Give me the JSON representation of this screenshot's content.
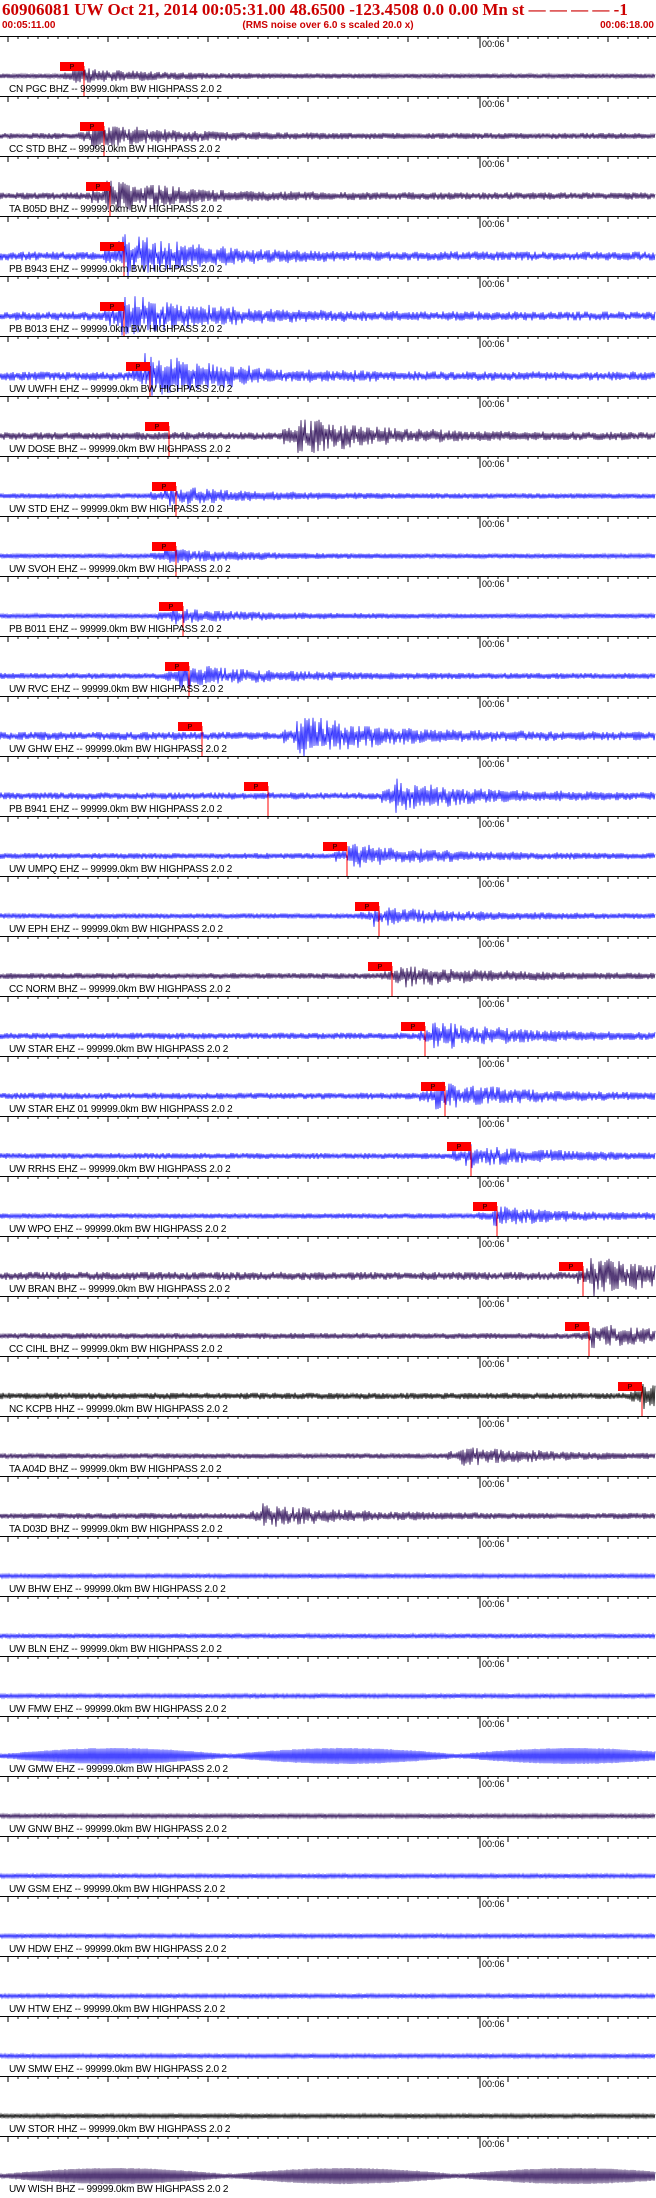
{
  "header": {
    "title": "60906081 UW Oct 21, 2014 00:05:31.00   48.6500  -123.4508   0.0  0.00  Mn  st  — — — —  -1",
    "start_time": "00:05:11.00",
    "rms_note": "(RMS noise over 6.0 s scaled 20.0 x)",
    "end_time": "00:06:18.00"
  },
  "minute_mark": "00:06",
  "pick_label": "P",
  "colors": {
    "trace_blue": "#1a1aff",
    "trace_dark": "#2a0a55",
    "trace_black": "#000000",
    "pick_red": "#ff0000",
    "header_red": "#cc0000"
  },
  "traces": [
    {
      "label": "CN PGC BHZ -- 99999.0km BW HIGHPASS  2.0  2",
      "color": "dark",
      "pick": 0.11,
      "amp": 0.3,
      "event": 0.11
    },
    {
      "label": "CC STD BHZ -- 99999.0km BW HIGHPASS  2.0  2",
      "color": "dark",
      "pick": 0.14,
      "amp": 0.5,
      "event": 0.14
    },
    {
      "label": "TA B05D BHZ -- 99999.0km BW HIGHPASS  2.0  2",
      "color": "dark",
      "pick": 0.15,
      "amp": 0.7,
      "event": 0.16
    },
    {
      "label": "PB B943 EHZ -- 99999.0km BW HIGHPASS  2.0  2",
      "color": "blue",
      "pick": 0.17,
      "amp": 1.0,
      "event": 0.18
    },
    {
      "label": "PB B013 EHZ -- 99999.0km BW HIGHPASS  2.0  2",
      "color": "blue",
      "pick": 0.17,
      "amp": 1.0,
      "event": 0.18
    },
    {
      "label": "UW UWFH EHZ -- 99999.0km BW HIGHPASS  2.0  2",
      "color": "blue",
      "pick": 0.21,
      "amp": 1.0,
      "event": 0.22
    },
    {
      "label": "UW DOSE BHZ -- 99999.0km BW HIGHPASS  2.0  2",
      "color": "dark",
      "pick": 0.24,
      "amp": 0.8,
      "event": 0.45
    },
    {
      "label": "UW STD EHZ -- 99999.0km BW HIGHPASS  2.0  2",
      "color": "blue",
      "pick": 0.25,
      "amp": 0.4,
      "event": 0.25
    },
    {
      "label": "UW SVOH EHZ -- 99999.0km BW HIGHPASS  2.0  2",
      "color": "blue",
      "pick": 0.25,
      "amp": 0.3,
      "event": 0.25
    },
    {
      "label": "PB B011 EHZ -- 99999.0km BW HIGHPASS  2.0  2",
      "color": "blue",
      "pick": 0.26,
      "amp": 0.3,
      "event": 0.26
    },
    {
      "label": "UW RVC EHZ -- 99999.0km BW HIGHPASS  2.0  2",
      "color": "blue",
      "pick": 0.27,
      "amp": 0.5,
      "event": 0.27
    },
    {
      "label": "UW GHW EHZ -- 99999.0km BW HIGHPASS  2.0  2",
      "color": "blue",
      "pick": 0.29,
      "amp": 0.9,
      "event": 0.45
    },
    {
      "label": "PB B941 EHZ -- 99999.0km BW HIGHPASS  2.0  2",
      "color": "blue",
      "pick": 0.39,
      "amp": 0.7,
      "event": 0.6
    },
    {
      "label": "UW UMPQ EHZ -- 99999.0km BW HIGHPASS  2.0  2",
      "color": "blue",
      "pick": 0.51,
      "amp": 0.5,
      "event": 0.53
    },
    {
      "label": "UW EPH EHZ -- 99999.0km BW HIGHPASS  2.0  2",
      "color": "blue",
      "pick": 0.56,
      "amp": 0.4,
      "event": 0.57
    },
    {
      "label": "CC NORM BHZ -- 99999.0km BW HIGHPASS  2.0  2",
      "color": "dark",
      "pick": 0.58,
      "amp": 0.5,
      "event": 0.6
    },
    {
      "label": "UW STAR EHZ -- 99999.0km BW HIGHPASS  2.0  2",
      "color": "blue",
      "pick": 0.63,
      "amp": 0.6,
      "event": 0.66
    },
    {
      "label": "UW STAR EHZ 01 99999.0km BW HIGHPASS  2.0  2",
      "color": "blue",
      "pick": 0.66,
      "amp": 0.6,
      "event": 0.66
    },
    {
      "label": "UW RRHS EHZ -- 99999.0km BW HIGHPASS  2.0  2",
      "color": "blue",
      "pick": 0.7,
      "amp": 0.5,
      "event": 0.71
    },
    {
      "label": "UW WPO EHZ -- 99999.0km BW HIGHPASS  2.0  2",
      "color": "blue",
      "pick": 0.74,
      "amp": 0.4,
      "event": 0.75
    },
    {
      "label": "UW BRAN BHZ -- 99999.0km BW HIGHPASS  2.0  2",
      "color": "dark",
      "pick": 0.87,
      "amp": 0.9,
      "event": 0.9
    },
    {
      "label": "CC CIHL BHZ -- 99999.0km BW HIGHPASS  2.0  2",
      "color": "dark",
      "pick": 0.88,
      "amp": 0.5,
      "event": 0.9
    },
    {
      "label": "NC KCPB HHZ -- 99999.0km BW HIGHPASS  2.0  2",
      "color": "black",
      "pick": 0.96,
      "amp": 0.6,
      "event": 0.98
    },
    {
      "label": "TA A04D BHZ -- 99999.0km BW HIGHPASS  2.0  2",
      "color": "dark",
      "pick": null,
      "amp": 0.4,
      "event": 0.7
    },
    {
      "label": "TA D03D BHZ -- 99999.0km BW HIGHPASS  2.0  2",
      "color": "dark",
      "pick": null,
      "amp": 0.5,
      "event": 0.4
    },
    {
      "label": "UW BHW EHZ -- 99999.0km BW HIGHPASS  2.0  2",
      "color": "blue",
      "pick": null,
      "amp": 0.2,
      "event": null
    },
    {
      "label": "UW BLN EHZ -- 99999.0km BW HIGHPASS  2.0  2",
      "color": "blue",
      "pick": null,
      "amp": 0.3,
      "event": null
    },
    {
      "label": "UW FMW EHZ -- 99999.0km BW HIGHPASS  2.0  2",
      "color": "blue",
      "pick": null,
      "amp": 0.2,
      "event": null
    },
    {
      "label": "UW GMW EHZ -- 99999.0km BW HIGHPASS  2.0  2",
      "color": "blue",
      "pick": null,
      "amp": 0.2,
      "event": null
    },
    {
      "label": "UW GNW BHZ -- 99999.0km BW HIGHPASS  2.0  2",
      "color": "dark",
      "pick": null,
      "amp": 0.2,
      "event": null
    },
    {
      "label": "UW GSM EHZ -- 99999.0km BW HIGHPASS  2.0  2",
      "color": "blue",
      "pick": null,
      "amp": 0.2,
      "event": null
    },
    {
      "label": "UW HDW EHZ -- 99999.0km BW HIGHPASS  2.0  2",
      "color": "blue",
      "pick": null,
      "amp": 0.2,
      "event": null
    },
    {
      "label": "UW HTW EHZ -- 99999.0km BW HIGHPASS  2.0  2",
      "color": "blue",
      "pick": null,
      "amp": 0.2,
      "event": null
    },
    {
      "label": "UW SMW EHZ -- 99999.0km BW HIGHPASS  2.0  2",
      "color": "blue",
      "pick": null,
      "amp": 0.2,
      "event": null
    },
    {
      "label": "UW STOR HHZ -- 99999.0km BW HIGHPASS  2.0  2",
      "color": "black",
      "pick": null,
      "amp": 0.2,
      "event": null
    },
    {
      "label": "UW WISH BHZ -- 99999.0km BW HIGHPASS  2.0  2",
      "color": "dark",
      "pick": null,
      "amp": 0.2,
      "event": null
    }
  ]
}
